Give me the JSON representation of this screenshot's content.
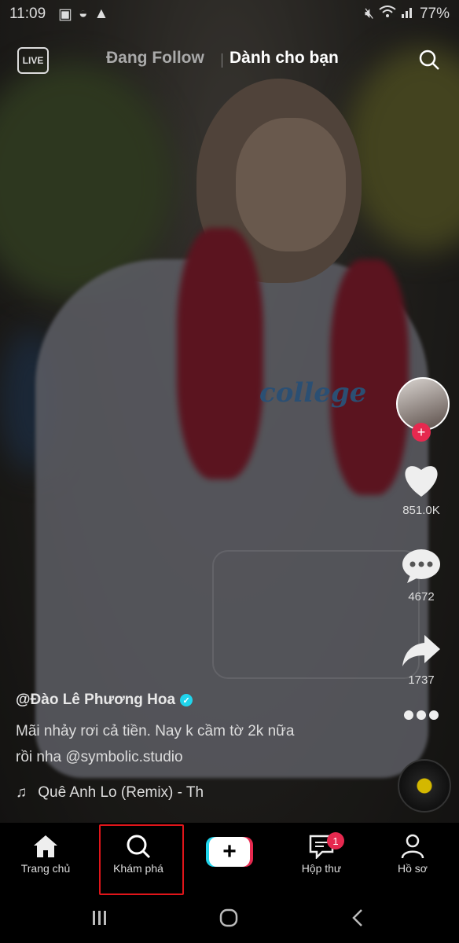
{
  "status_bar": {
    "time": "11:09",
    "battery": "77%",
    "icons_left": [
      "image-icon",
      "half-circle-icon",
      "warning-icon"
    ],
    "icons_right": [
      "mute-icon",
      "wifi-icon",
      "signal-icon"
    ]
  },
  "top_nav": {
    "live_label": "LIVE",
    "following_tab": "Đang Follow",
    "for_you_tab": "Dành cho bạn"
  },
  "video": {
    "print_text": "college"
  },
  "right_rail": {
    "likes": "851.0K",
    "comments": "4672",
    "shares": "1737"
  },
  "caption": {
    "author": "@Đào Lê Phương Hoa",
    "description_line1": "Mãi nhảy rơi cả tiền. Nay k cầm tờ 2k nữa",
    "description_line2": "rồi nha @symbolic.studio",
    "music": "Quê Anh Lo (Remix) - Th"
  },
  "bottom_nav": {
    "home": "Trang chủ",
    "discover": "Khám phá",
    "inbox": "Hộp thư",
    "inbox_badge": "1",
    "profile": "Hồ sơ"
  },
  "colors": {
    "accent": "#e6294f",
    "teal": "#20d5ec",
    "highlight": "#e0151a"
  }
}
